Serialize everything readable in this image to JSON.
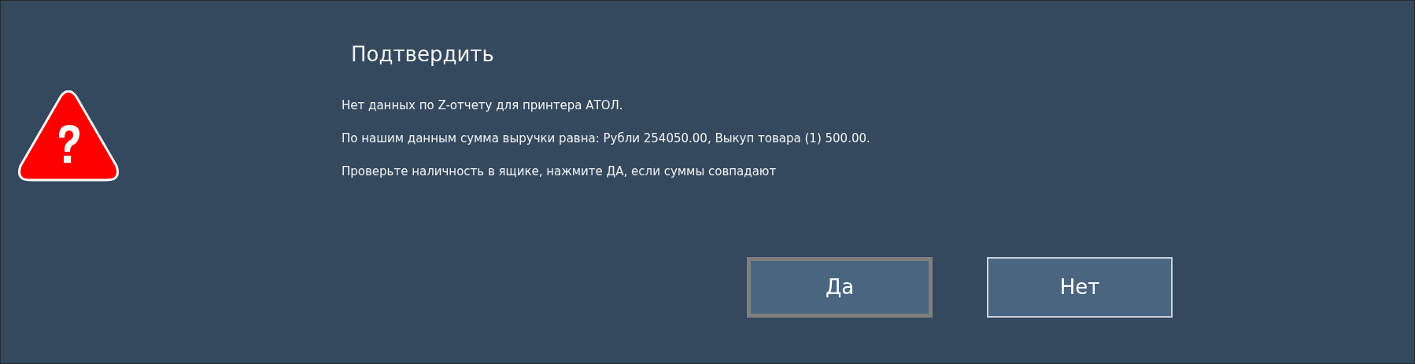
{
  "dialog": {
    "title": "Подтвердить",
    "message_lines": [
      "Нет данных по Z-отчету для принтера АТОЛ.",
      "По нашим данным сумма выручки равна: Рубли 254050.00, Выкуп товара (1) 500.00.",
      "Проверьте наличность в ящике, нажмите ДА, если суммы совпадают"
    ],
    "buttons": [
      {
        "label": "Да",
        "focused": true
      },
      {
        "label": "Нет",
        "focused": false
      }
    ]
  }
}
